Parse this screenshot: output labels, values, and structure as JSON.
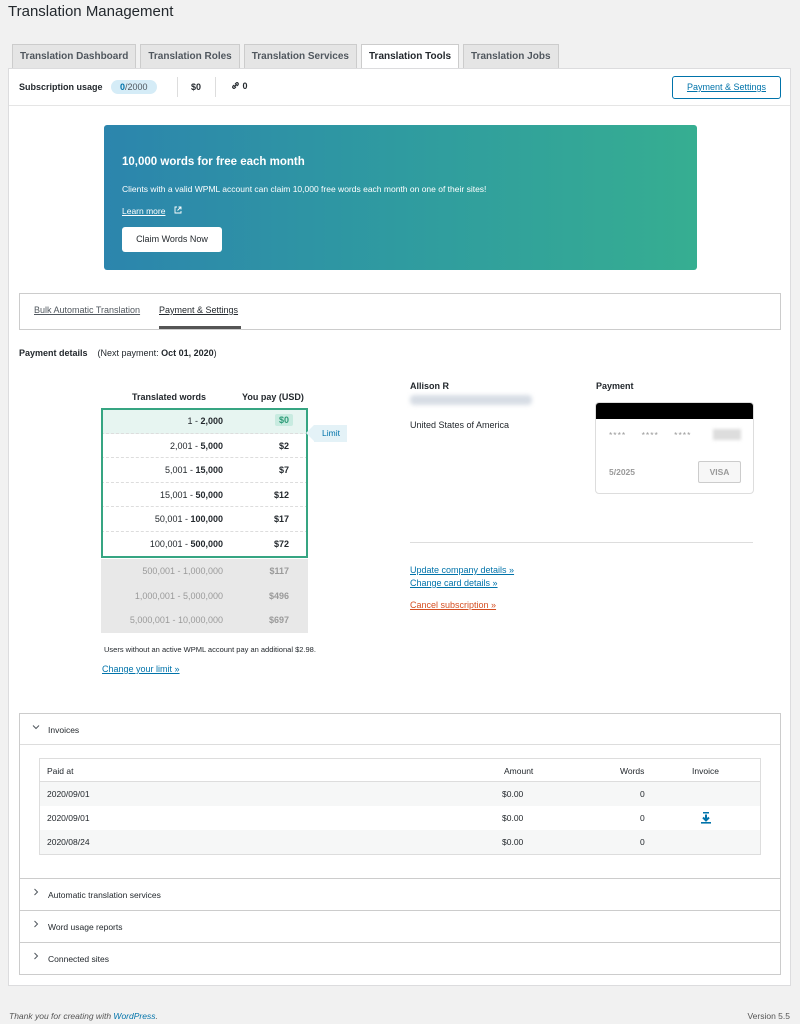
{
  "page": {
    "title": "Translation Management"
  },
  "tabs": [
    {
      "label": "Translation Dashboard"
    },
    {
      "label": "Translation Roles"
    },
    {
      "label": "Translation Services"
    },
    {
      "label": "Translation Tools"
    },
    {
      "label": "Translation Jobs"
    }
  ],
  "usage": {
    "label": "Subscription usage",
    "used": "0",
    "total": "/2000",
    "cost": "$0",
    "sites": "0",
    "payment_button": "Payment & Settings"
  },
  "promo": {
    "title": "10,000 words for free each month",
    "text": "Clients with a valid WPML account can claim 10,000 free words each month on one of their sites!",
    "link": "Learn more",
    "button": "Claim Words Now"
  },
  "subtabs": [
    {
      "label": "Bulk Automatic Translation"
    },
    {
      "label": "Payment & Settings"
    }
  ],
  "payment_details": {
    "title": "Payment details",
    "next_prefix": "(Next payment: ",
    "next_date": "Oct 01, 2020",
    "next_suffix": ")"
  },
  "pricing": {
    "col_words": "Translated words",
    "col_pay": "You pay (USD)",
    "limit_label": "Limit",
    "rows": [
      {
        "from": "1 - ",
        "to": "2,000",
        "price": "$0"
      },
      {
        "from": "2,001 - ",
        "to": "5,000",
        "price": "$2"
      },
      {
        "from": "5,001 - ",
        "to": "15,000",
        "price": "$7"
      },
      {
        "from": "15,001 - ",
        "to": "50,000",
        "price": "$12"
      },
      {
        "from": "50,001 - ",
        "to": "100,000",
        "price": "$17"
      },
      {
        "from": "100,001 - ",
        "to": "500,000",
        "price": "$72"
      },
      {
        "from": "500,001 - ",
        "to": "1,000,000",
        "price": "$117"
      },
      {
        "from": "1,000,001 - ",
        "to": "5,000,000",
        "price": "$496"
      },
      {
        "from": "5,000,001 - ",
        "to": "10,000,000",
        "price": "$697"
      }
    ],
    "note": "Users without an active WPML account pay an additional $2.98.",
    "change_limit": "Change your limit »"
  },
  "customer": {
    "name": "Allison R",
    "country": "United States of America"
  },
  "card": {
    "label": "Payment",
    "number": "**** **** ****",
    "expiry": "5/2025",
    "brand": "VISA"
  },
  "actions": {
    "update_company": "Update company details »",
    "change_card": "Change card details »",
    "cancel": "Cancel subscription »"
  },
  "invoices": {
    "title": "Invoices",
    "headers": {
      "paid_at": "Paid at",
      "amount": "Amount",
      "words": "Words",
      "invoice": "Invoice"
    },
    "rows": [
      {
        "paid_at": "2020/09/01",
        "amount": "$0.00",
        "words": "0"
      },
      {
        "paid_at": "2020/09/01",
        "amount": "$0.00",
        "words": "0"
      },
      {
        "paid_at": "2020/08/24",
        "amount": "$0.00",
        "words": "0"
      }
    ]
  },
  "sections": [
    {
      "label": "Automatic translation services"
    },
    {
      "label": "Word usage reports"
    },
    {
      "label": "Connected sites"
    }
  ],
  "footer": {
    "text": "Thank you for creating with ",
    "link": "WordPress",
    "suffix": ".",
    "version": "Version 5.5"
  },
  "colors": {
    "accent": "#0073aa",
    "limit_green": "#36a582",
    "cancel_red": "#d54e21"
  }
}
